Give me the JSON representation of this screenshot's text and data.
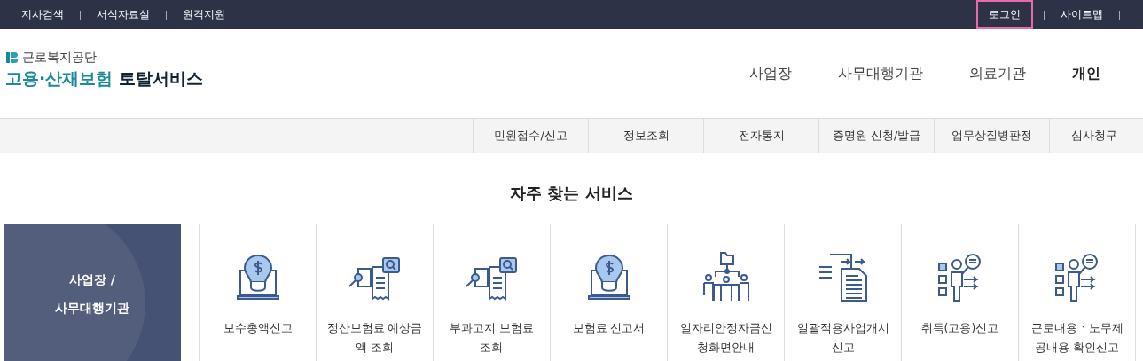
{
  "top_bar": {
    "left_links": [
      {
        "label": "지사검색"
      },
      {
        "label": "서식자료실"
      },
      {
        "label": "원격지원"
      }
    ],
    "right_links": [
      {
        "label": "로그인",
        "focused": true
      },
      {
        "label": "사이트맵",
        "focused": false
      }
    ]
  },
  "logo": {
    "org": "근로복지공단",
    "title_accent": "고용·산재보험",
    "title": "토탈서비스"
  },
  "main_nav": [
    {
      "label": "사업장",
      "selected": false
    },
    {
      "label": "사무대행기관",
      "selected": false
    },
    {
      "label": "의료기관",
      "selected": false
    },
    {
      "label": "개인",
      "selected": true
    }
  ],
  "sub_nav": [
    {
      "label": "민원접수/신고"
    },
    {
      "label": "정보조회"
    },
    {
      "label": "전자통지"
    },
    {
      "label": "증명원 신청/발급"
    },
    {
      "label": "업무상질병판정"
    },
    {
      "label": "심사청구"
    }
  ],
  "section_title": "자주 찾는 서비스",
  "category_panel": {
    "lines": [
      "사업장 /",
      "사무대행기관"
    ]
  },
  "services": [
    {
      "label": "보수총액신고",
      "kind": "bulb"
    },
    {
      "label": "정산보험료 예상금\n액 조회",
      "kind": "docsearch"
    },
    {
      "label": "부과고지 보험료\n조회",
      "kind": "docsearch"
    },
    {
      "label": "보험료 신고서",
      "kind": "bulb"
    },
    {
      "label": "일자리안정자금신\n청화면안내",
      "kind": "org"
    },
    {
      "label": "일괄적용사업개시\n신고",
      "kind": "transfer"
    },
    {
      "label": "취득(고용)신고",
      "kind": "person"
    },
    {
      "label": "근로내용ㆍ노무제\n공내용 확인신고",
      "kind": "person"
    }
  ]
}
